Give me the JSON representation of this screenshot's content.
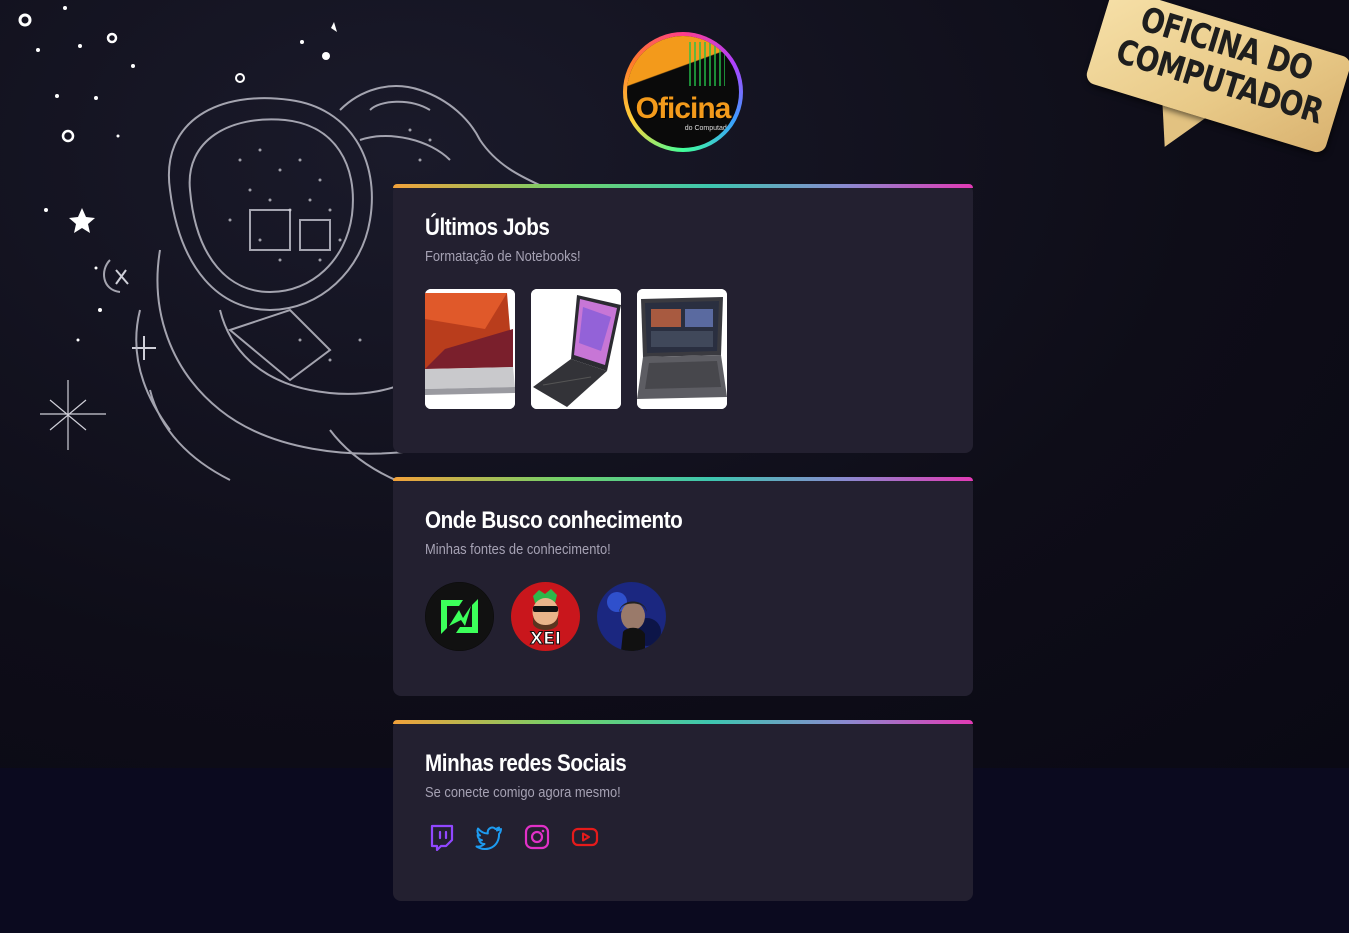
{
  "logo": {
    "name": "Oficina",
    "sub": "do Computador"
  },
  "banner": {
    "line1": "OFICINA DO",
    "line2": "COMPUTADOR"
  },
  "cards": {
    "jobs": {
      "title": "Últimos Jobs",
      "subtitle": "Formatação de Notebooks!",
      "items": [
        "laptop-1",
        "laptop-2",
        "laptop-3"
      ]
    },
    "sources": {
      "title": "Onde Busco conhecimento",
      "subtitle": "Minhas fontes de conhecimento!",
      "items": [
        "source-green-logo",
        "source-xei-avatar",
        "source-person-avatar"
      ]
    },
    "social": {
      "title": "Minhas redes Sociais",
      "subtitle": "Se conecte comigo agora mesmo!",
      "links": [
        {
          "icon": "twitch-icon",
          "color": "#9147ff"
        },
        {
          "icon": "twitter-icon",
          "color": "#1d9bf0"
        },
        {
          "icon": "instagram-icon",
          "color": "#e130c7"
        },
        {
          "icon": "youtube-icon",
          "color": "#e51b1b"
        }
      ]
    }
  },
  "colors": {
    "background": "#0c0b1a",
    "card": "#232030",
    "accent_orange": "#f39a1b"
  }
}
